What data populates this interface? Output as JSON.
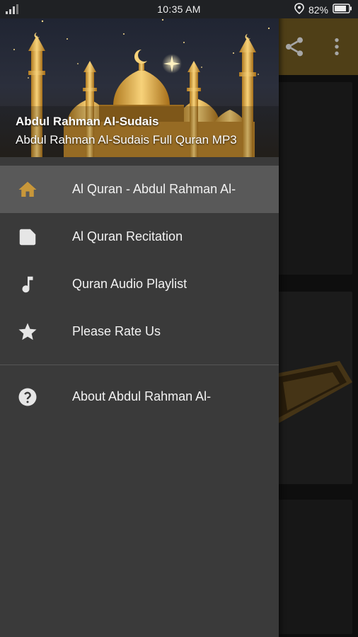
{
  "status_bar": {
    "signal_icon": "signal-icon",
    "time": "10:35 AM",
    "location_icon": "location-icon",
    "battery": "82%",
    "battery_icon": "battery-icon"
  },
  "app_toolbar": {
    "share_icon": "share-icon",
    "overflow_icon": "more-vert-icon",
    "color": "#7a6224"
  },
  "drawer": {
    "header": {
      "title": "Abdul Rahman Al-Sudais",
      "subtitle": "Abdul Rahman Al-Sudais Full Quran MP3",
      "image": "mosque-illustration"
    },
    "items": [
      {
        "label": "Al Quran - Abdul Rahman Al-",
        "icon": "home-icon",
        "active": true
      },
      {
        "label": "Al Quran Recitation",
        "icon": "note-icon",
        "active": false
      },
      {
        "label": "Quran Audio Playlist",
        "icon": "music-note-icon",
        "active": false
      },
      {
        "label": "Please Rate Us",
        "icon": "star-icon",
        "active": false
      }
    ],
    "secondary_items": [
      {
        "label": "About Abdul Rahman Al-",
        "icon": "help-icon"
      }
    ]
  },
  "colors": {
    "accent": "#c8973a",
    "drawer_bg": "#3a3a3a",
    "active_row": "#595959"
  }
}
